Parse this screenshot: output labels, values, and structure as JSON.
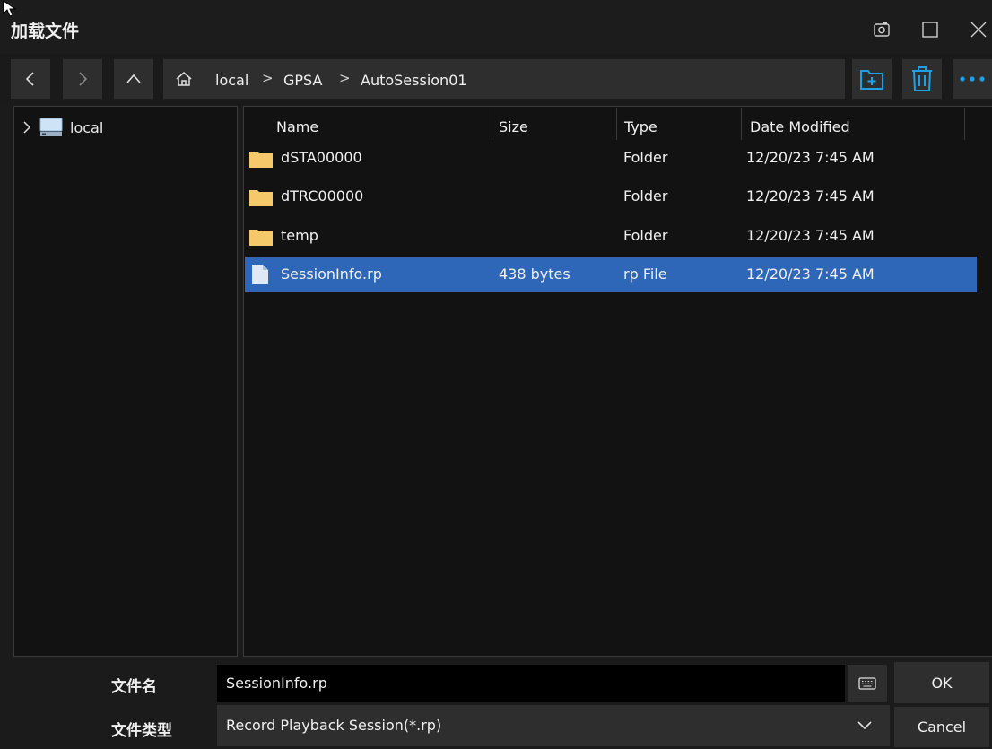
{
  "window": {
    "title": "加载文件",
    "controls": [
      "camera-icon",
      "maximize-icon",
      "close-icon"
    ]
  },
  "nav": {
    "breadcrumbs": [
      "local",
      "GPSA",
      "AutoSession01"
    ],
    "separator": ">"
  },
  "tree": {
    "items": [
      {
        "label": "local",
        "icon": "drive-icon"
      }
    ]
  },
  "list": {
    "columns": [
      "Name",
      "Size",
      "Type",
      "Date Modified"
    ],
    "rows": [
      {
        "name": "dSTA00000",
        "size": "",
        "type": "Folder",
        "date": "12/20/23 7:45 AM",
        "icon": "folder-icon"
      },
      {
        "name": "dTRC00000",
        "size": "",
        "type": "Folder",
        "date": "12/20/23 7:45 AM",
        "icon": "folder-icon"
      },
      {
        "name": "temp",
        "size": "",
        "type": "Folder",
        "date": "12/20/23 7:45 AM",
        "icon": "folder-icon"
      },
      {
        "name": "SessionInfo.rp",
        "size": "438 bytes",
        "type": "rp File",
        "date": "12/20/23 7:45 AM",
        "icon": "file-icon",
        "selected": true
      }
    ]
  },
  "bottom": {
    "filename_label": "文件名",
    "filename_value": "SessionInfo.rp",
    "filetype_label": "文件类型",
    "filetype_value": "Record Playback Session(*.rp)",
    "ok_label": "OK",
    "cancel_label": "Cancel"
  },
  "colors": {
    "accent": "#1ea0e6",
    "selection": "#2f67b8",
    "folder": "#f5c86a"
  }
}
